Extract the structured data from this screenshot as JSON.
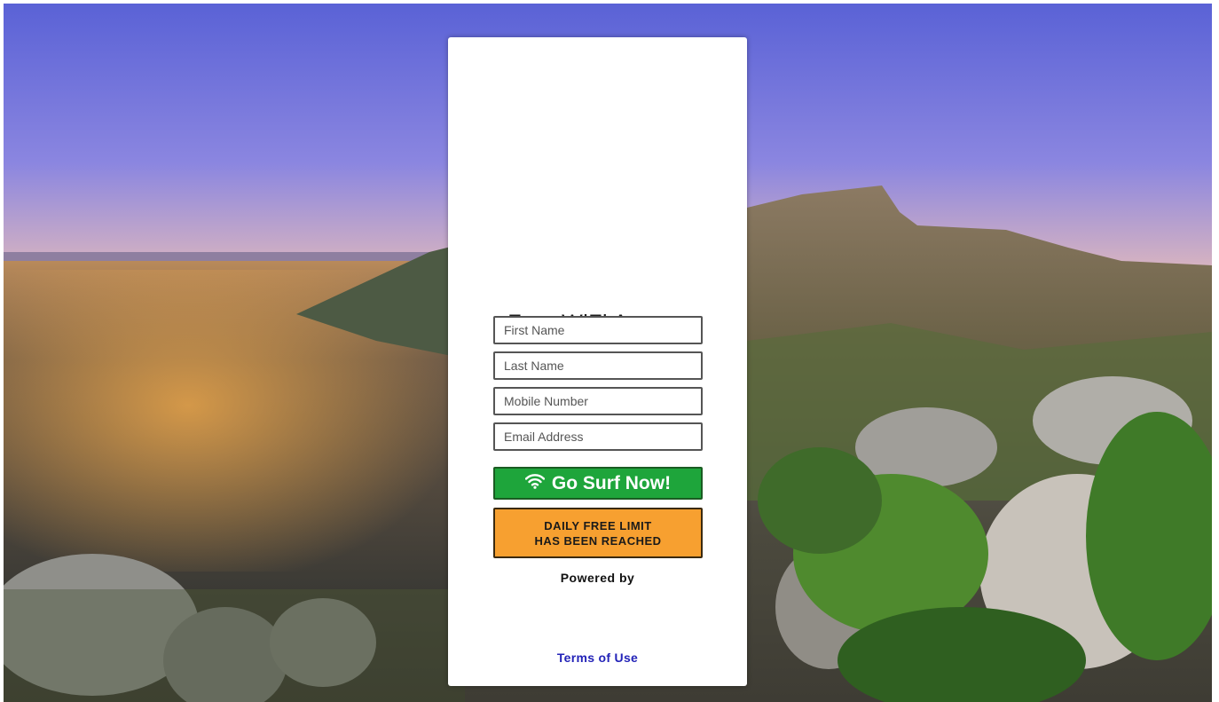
{
  "page": {
    "title": "Free WiFi Access",
    "background_image": "landscape-city-mountain"
  },
  "form": {
    "first_name": {
      "placeholder": "First Name",
      "value": ""
    },
    "last_name": {
      "placeholder": "Last Name",
      "value": ""
    },
    "mobile": {
      "placeholder": "Mobile Number",
      "value": ""
    },
    "email": {
      "placeholder": "Email Address",
      "value": ""
    }
  },
  "buttons": {
    "surf_label": "Go Surf Now!",
    "surf_icon": "wifi-icon",
    "surf_color": "#1ea53b"
  },
  "notice": {
    "line1": "DAILY FREE LIMIT",
    "line2": "HAS BEEN REACHED",
    "color": "#f7a030"
  },
  "footer": {
    "powered_by": "Powered by",
    "terms_link": "Terms of Use",
    "link_color": "#2323b8"
  }
}
